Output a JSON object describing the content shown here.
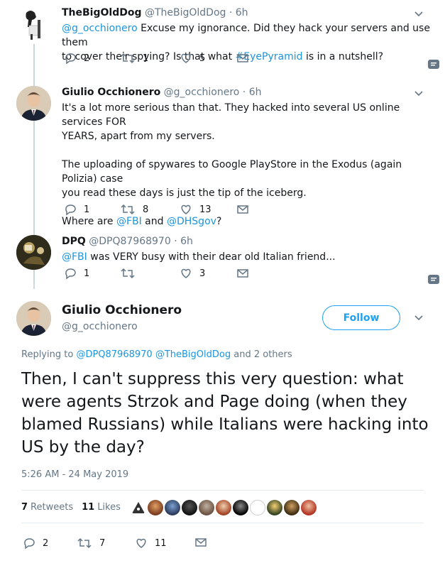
{
  "tweets": [
    {
      "name": "TheBigOldDog",
      "handle": "@TheBigOldDog · 6h",
      "mention": "@g_occhionero",
      "text_a": " Excuse my ignorance. Did they hack your servers and use them\nto cover their spying? Is that what ",
      "hashtag": "#EyePyramid",
      "text_b": " is in a nutshell?",
      "replies": "2",
      "retweets": "1",
      "likes": "5"
    },
    {
      "name": "Giulio Occhionero",
      "handle": "@g_occhionero · 6h",
      "para1": "It's a lot more serious than that. They hacked into several US online services FOR\nYEARS, apart from my servers.",
      "para2": "The uploading of spywares to Google PlayStore in the Exodus (again Polizia) case\nyou read these days is just the tip of the iceberg.",
      "para3_a": "Where are ",
      "mention1": "@FBI",
      "para3_b": " and ",
      "mention2": "@DHSgov",
      "para3_c": "?",
      "replies": "1",
      "retweets": "8",
      "likes": "13"
    },
    {
      "name": "DPQ",
      "handle": "@DPQ87968970 · 6h",
      "mention": "@FBI",
      "text": " was VERY busy with their dear old Italian friend...",
      "replies": "1",
      "retweets": "",
      "likes": "3"
    }
  ],
  "main": {
    "name": "Giulio Occhionero",
    "handle": "@g_occhionero",
    "follow_label": "Follow",
    "replying_prefix": "Replying to ",
    "replying_1": "@DPQ87968970",
    "replying_2": "@TheBigOldDog",
    "replying_suffix": " and 2 others",
    "text": "Then, I can't suppress this very question: what were agents Strzok and Page doing (when they blamed Russians) while Italians were hacking into US by the day?",
    "timestamp": "5:26 AM - 24 May 2019",
    "retweets_count": "7",
    "retweets_label": "Retweets",
    "likes_count": "11",
    "likes_label": "Likes",
    "replies": "2",
    "retweets": "7",
    "likes": "11"
  },
  "colors": {
    "link": "#1b95e0",
    "follow": "#1da1f2",
    "muted": "#657786",
    "thread_line": "#ccd6dd"
  },
  "icons": [
    "reply-icon",
    "retweet-icon",
    "heart-icon",
    "envelope-icon",
    "caret-down-icon",
    "dm-badge-icon"
  ]
}
